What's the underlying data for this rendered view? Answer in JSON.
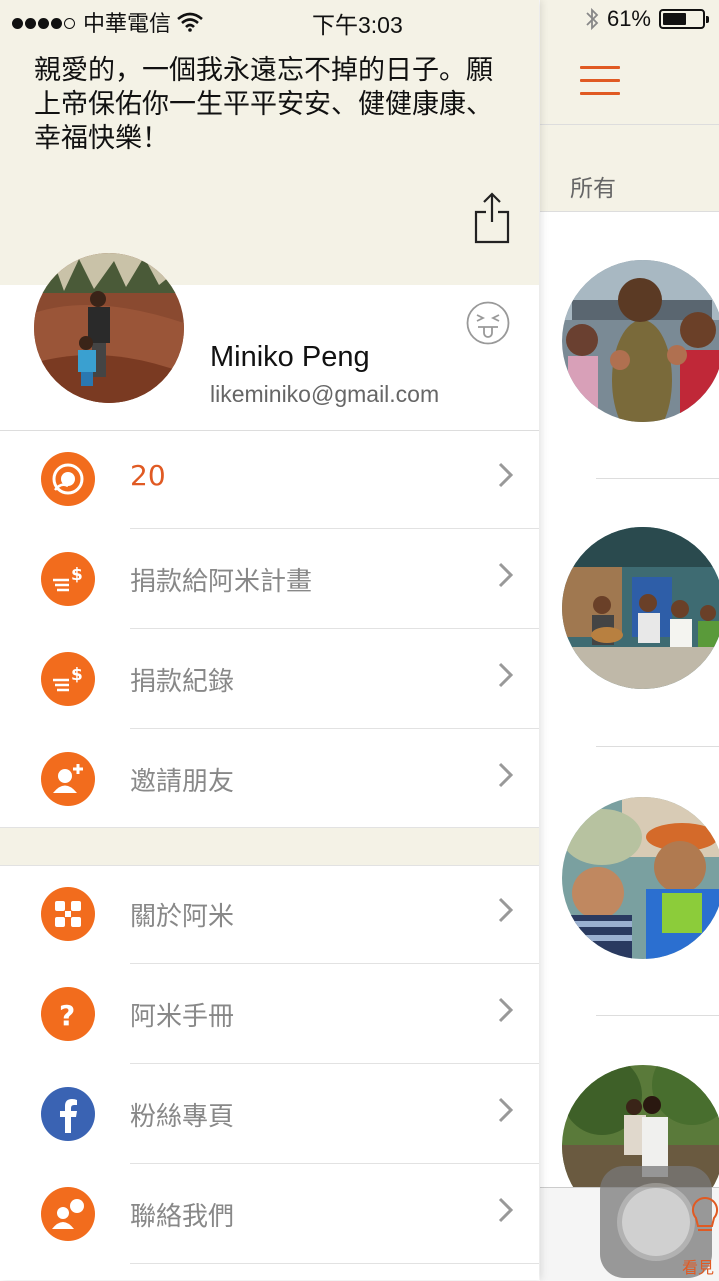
{
  "status_bar": {
    "carrier": "中華電信",
    "time": "下午3:03",
    "battery": "61%",
    "battery_level": 0.61
  },
  "drawer": {
    "quote": "親愛的，一個我永遠忘不掉的日子。願上帝保佑你一生平平安安、健健康康、幸福快樂！",
    "user": {
      "name": "Miniko Peng",
      "email": "likeminiko@gmail.com"
    },
    "menu_group_1": [
      {
        "label": "20",
        "icon": "points-icon"
      },
      {
        "label": "捐款給阿米計畫",
        "icon": "donate-icon"
      },
      {
        "label": "捐款紀錄",
        "icon": "donation-history-icon"
      },
      {
        "label": "邀請朋友",
        "icon": "invite-friend-icon"
      }
    ],
    "menu_group_2": [
      {
        "label": "關於阿米",
        "icon": "about-icon"
      },
      {
        "label": "阿米手冊",
        "icon": "help-icon"
      },
      {
        "label": "粉絲專頁",
        "icon": "facebook-icon"
      },
      {
        "label": "聯絡我們",
        "icon": "contact-icon"
      }
    ]
  },
  "main": {
    "tab_label": "所有",
    "bottom_label": "看見"
  },
  "colors": {
    "accent": "#e05a23",
    "icon_orange": "#f26c1d",
    "facebook_blue": "#3a63b3",
    "header_bg": "#f4f2e6"
  }
}
